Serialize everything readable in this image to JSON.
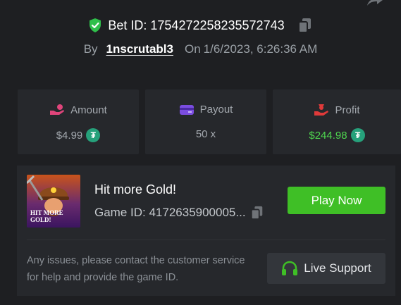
{
  "header": {
    "bet_id_text": "Bet ID: 1754272258235572743",
    "by_label": "By",
    "username": "1nscrutabl3",
    "on_label": "On",
    "date": "1/6/2023, 6:26:36 AM"
  },
  "stats": {
    "amount": {
      "label": "Amount",
      "value": "$4.99",
      "currency_icon": "tether-icon"
    },
    "payout": {
      "label": "Payout",
      "value": "50 x"
    },
    "profit": {
      "label": "Profit",
      "value": "$244.98",
      "currency_icon": "tether-icon"
    }
  },
  "game": {
    "thumbnail_text": "HIT MORE GOLD!",
    "title": "Hit more Gold!",
    "game_id_text": "Game ID: 4172635900005...",
    "play_button": "Play Now"
  },
  "support": {
    "notice": "Any issues, please contact the customer service for help and provide the game ID.",
    "button_label": "Live Support"
  },
  "colors": {
    "background": "#1e1f22",
    "panel": "#26282c",
    "accent_green": "#3fbf26",
    "profit_green": "#4fd64f",
    "tether_green": "#26a17b",
    "icon_pink": "#e0457b",
    "icon_purple": "#7b4de0",
    "icon_red": "#e03a3a"
  }
}
